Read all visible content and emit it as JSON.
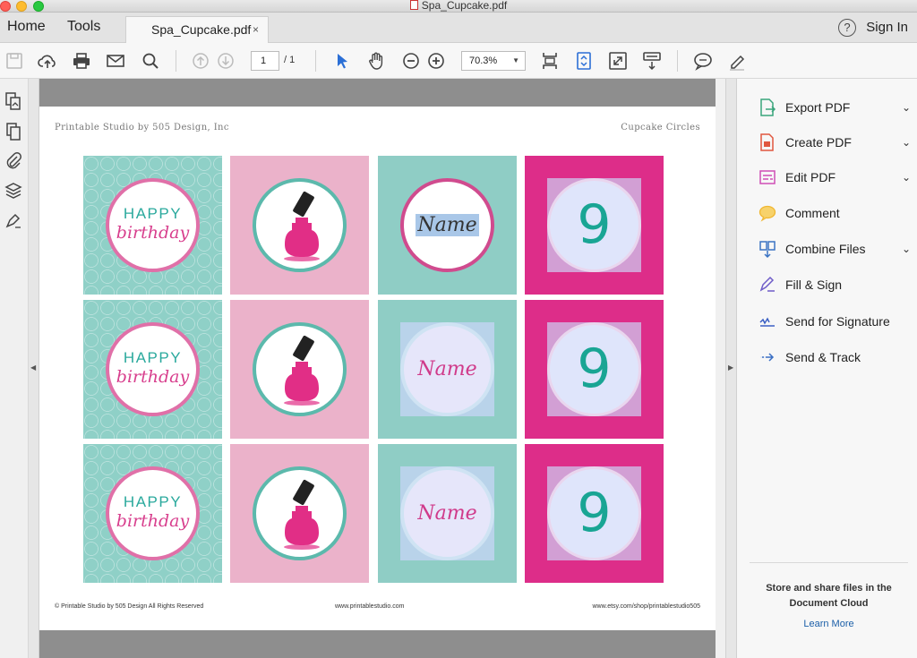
{
  "window": {
    "title": "Spa_Cupcake.pdf"
  },
  "tabs": {
    "home": "Home",
    "tools": "Tools",
    "document_tab": "Spa_Cupcake.pdf",
    "close_glyph": "×",
    "sign_in": "Sign In",
    "help_glyph": "?"
  },
  "toolbar": {
    "page_current": "1",
    "page_total": "/ 1",
    "zoom": "70.3%"
  },
  "page": {
    "header_left": "Printable Studio by 505 Design, Inc",
    "header_right": "Cupcake Circles",
    "footer_left": "© Printable Studio by 505 Design All Rights Reserved",
    "footer_center": "www.printablestudio.com",
    "footer_right": "www.etsy.com/shop/printablestudio505",
    "happy": "HAPPY",
    "birthday": "birthday",
    "name": "Name",
    "number": "9"
  },
  "right_panel": {
    "items": [
      {
        "label": "Export PDF",
        "icon": "export-pdf-icon",
        "chevron": true,
        "color": "#3aa57c"
      },
      {
        "label": "Create PDF",
        "icon": "create-pdf-icon",
        "chevron": true,
        "color": "#e0573f"
      },
      {
        "label": "Edit PDF",
        "icon": "edit-pdf-icon",
        "chevron": true,
        "color": "#cf4fb5"
      },
      {
        "label": "Comment",
        "icon": "comment-icon",
        "chevron": false,
        "color": "#f0b732"
      },
      {
        "label": "Combine Files",
        "icon": "combine-files-icon",
        "chevron": true,
        "color": "#3b74c4"
      },
      {
        "label": "Fill & Sign",
        "icon": "fill-sign-icon",
        "chevron": false,
        "color": "#6f5cc8"
      },
      {
        "label": "Send for Signature",
        "icon": "send-signature-icon",
        "chevron": false,
        "color": "#3a5fc4"
      },
      {
        "label": "Send & Track",
        "icon": "send-track-icon",
        "chevron": false,
        "color": "#3a6fc4"
      }
    ],
    "chevron_glyph": "⌄",
    "cloud_line1": "Store and share files in the",
    "cloud_line2": "Document Cloud",
    "learn_more": "Learn More"
  }
}
